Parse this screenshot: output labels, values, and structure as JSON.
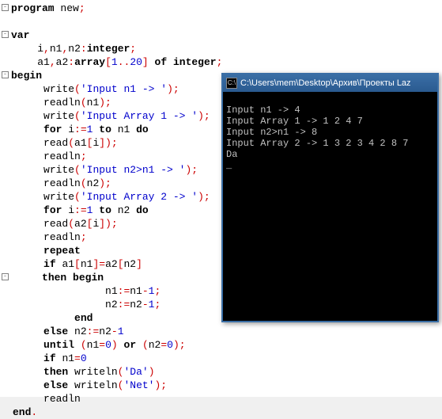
{
  "code": {
    "l1": "program",
    "l1b": "new",
    "l3": "var",
    "l4a": "i",
    "l4b": "n1",
    "l4c": "n2",
    "l4d": "integer",
    "l5a": "a1",
    "l5b": "a2",
    "l5c": "array",
    "l5d": "1",
    "l5e": "20",
    "l5f": "of",
    "l5g": "integer",
    "l6": "begin",
    "l7a": "write",
    "l7b": "'Input n1 -> '",
    "l8a": "readln",
    "l8b": "n1",
    "l9a": "write",
    "l9b": "'Input Array 1 -> '",
    "l10a": "for",
    "l10b": "i",
    "l10c": "1",
    "l10d": "to",
    "l10e": "n1",
    "l10f": "do",
    "l11a": "read",
    "l11b": "a1",
    "l11c": "i",
    "l12a": "readln",
    "l13a": "write",
    "l13b": "'Input n2>n1 -> '",
    "l14a": "readln",
    "l14b": "n2",
    "l15a": "write",
    "l15b": "'Input Array 2 -> '",
    "l16a": "for",
    "l16b": "i",
    "l16c": "1",
    "l16d": "to",
    "l16e": "n2",
    "l16f": "do",
    "l17a": "read",
    "l17b": "a2",
    "l17c": "i",
    "l18a": "readln",
    "l19a": "repeat",
    "l20a": "if",
    "l20b": "a1",
    "l20c": "n1",
    "l20d": "a2",
    "l20e": "n2",
    "l21a": "then",
    "l21b": "begin",
    "l22a": "n1",
    "l22b": "n1",
    "l22c": "1",
    "l23a": "n2",
    "l23b": "n2",
    "l23c": "1",
    "l24a": "end",
    "l25a": "else",
    "l25b": "n2",
    "l25c": "n2",
    "l25d": "1",
    "l26a": "until",
    "l26b": "n1",
    "l26c": "0",
    "l26d": "or",
    "l26e": "n2",
    "l26f": "0",
    "l27a": "if",
    "l27b": "n1",
    "l27c": "0",
    "l28a": "then",
    "l28b": "writeln",
    "l28c": "'Da'",
    "l29a": "else",
    "l29b": "writeln",
    "l29c": "'Net'",
    "l30a": "readln",
    "l31a": "end"
  },
  "console": {
    "icon": "C:\\",
    "title": "C:\\Users\\mem\\Desktop\\Архив\\Проекты Laz",
    "line1": "Input n1 -> 4",
    "line2": "Input Array 1 -> 1 2 4 7",
    "line3": "Input n2>n1 -> 8",
    "line4": "Input Array 2 -> 1 3 2 3 4 2 8 7",
    "line5": "Da",
    "cursor": "_"
  }
}
